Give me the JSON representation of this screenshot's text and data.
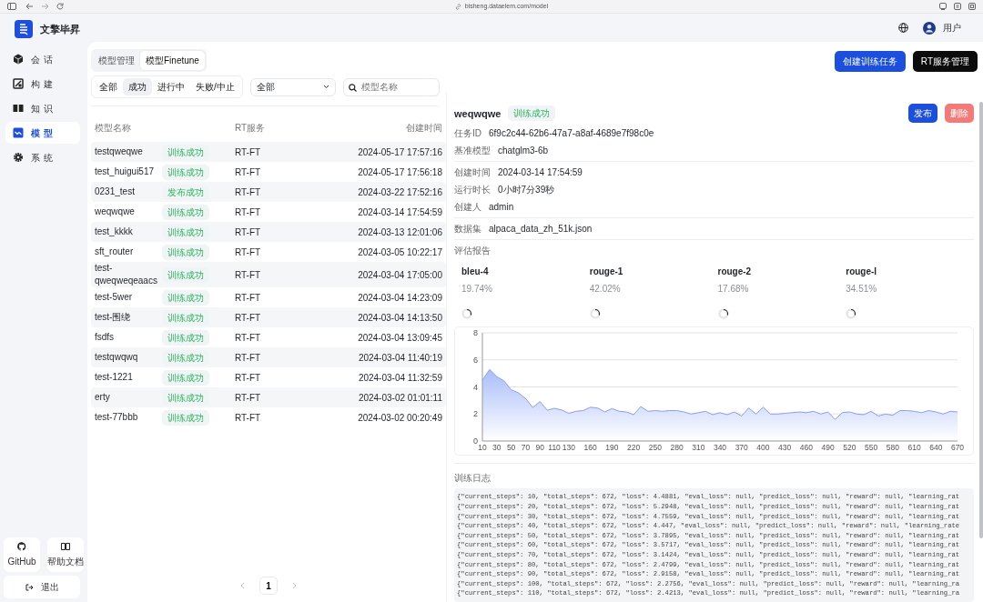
{
  "browser": {
    "url": "bisheng.dataelem.com/model"
  },
  "app": {
    "name": "文擎毕昇"
  },
  "header": {
    "user": "用户"
  },
  "sidebar": {
    "items": [
      {
        "label": "会话",
        "selected": false
      },
      {
        "label": "构建",
        "selected": false
      },
      {
        "label": "知识",
        "selected": false
      },
      {
        "label": "模型",
        "selected": true
      },
      {
        "label": "系统",
        "selected": false
      }
    ],
    "links": [
      {
        "label": "GitHub"
      },
      {
        "label": "帮助文档"
      }
    ],
    "logout": "退出"
  },
  "tabs": [
    {
      "label": "模型管理",
      "selected": false
    },
    {
      "label": "模型Finetune",
      "selected": true
    }
  ],
  "status_filter": [
    {
      "label": "全部",
      "selected": false
    },
    {
      "label": "成功",
      "selected": true
    },
    {
      "label": "进行中",
      "selected": false
    },
    {
      "label": "失败/中止",
      "selected": false
    }
  ],
  "type_select": {
    "value": "全部"
  },
  "search": {
    "placeholder": "模型名称"
  },
  "actions": [
    {
      "label": "创建训练任务",
      "kind": "primary"
    },
    {
      "label": "RT服务管理",
      "kind": "dark"
    }
  ],
  "table": {
    "columns": [
      "模型名称",
      "RT服务",
      "创建时间"
    ],
    "rows": [
      {
        "name": "testqweqwe",
        "status": "训练成功",
        "service": "RT-FT",
        "created": "2024-05-17 17:57:16"
      },
      {
        "name": "test_huigui517",
        "status": "训练成功",
        "service": "RT-FT",
        "created": "2024-05-17 17:56:18"
      },
      {
        "name": "0231_test",
        "status": "发布成功",
        "service": "RT-FT",
        "created": "2024-03-22 17:52:16"
      },
      {
        "name": "weqwqwe",
        "status": "训练成功",
        "service": "RT-FT",
        "created": "2024-03-14 17:54:59"
      },
      {
        "name": "test_kkkk",
        "status": "训练成功",
        "service": "RT-FT",
        "created": "2024-03-13 12:01:06"
      },
      {
        "name": "sft_router",
        "status": "训练成功",
        "service": "RT-FT",
        "created": "2024-03-05 10:22:17"
      },
      {
        "name": "test-qweqweqeaacs",
        "status": "训练成功",
        "service": "RT-FT",
        "created": "2024-03-04 17:05:00"
      },
      {
        "name": "test-5wer",
        "status": "训练成功",
        "service": "RT-FT",
        "created": "2024-03-04 14:23:09"
      },
      {
        "name": "test-围绕",
        "status": "训练成功",
        "service": "RT-FT",
        "created": "2024-03-04 14:13:50"
      },
      {
        "name": "fsdfs",
        "status": "训练成功",
        "service": "RT-FT",
        "created": "2024-03-04 13:09:45"
      },
      {
        "name": "testqwqwq",
        "status": "训练成功",
        "service": "RT-FT",
        "created": "2024-03-04 11:40:19"
      },
      {
        "name": "test-1221",
        "status": "训练成功",
        "service": "RT-FT",
        "created": "2024-03-04 11:32:59"
      },
      {
        "name": "erty",
        "status": "训练成功",
        "service": "RT-FT",
        "created": "2024-03-02 01:01:11"
      },
      {
        "name": "test-77bbb",
        "status": "训练成功",
        "service": "RT-FT",
        "created": "2024-03-02 00:20:49"
      }
    ]
  },
  "pagination": {
    "pages": [
      {
        "label": "1",
        "selected": true
      }
    ]
  },
  "detail": {
    "title": "weqwqwe",
    "status": "训练成功",
    "buttons": [
      {
        "label": "发布",
        "kind": "primary"
      },
      {
        "label": "删除",
        "kind": "danger"
      }
    ],
    "groups": [
      [
        {
          "label": "任务ID",
          "value": "6f9c2c44-62b6-47a7-a8af-4689e7f98c0e"
        },
        {
          "label": "基准模型",
          "value": "chatglm3-6b"
        }
      ],
      [
        {
          "label": "创建时间",
          "value": "2024-03-14 17:54:59"
        },
        {
          "label": "运行时长",
          "value": "0小时7分39秒"
        },
        {
          "label": "创建人",
          "value": "admin"
        }
      ],
      [
        {
          "label": "数据集",
          "value": "alpaca_data_zh_51k.json"
        }
      ]
    ],
    "report_title": "评估报告",
    "metrics": [
      {
        "name": "bleu-4",
        "value": "19.74%"
      },
      {
        "name": "rouge-1",
        "value": "42.02%"
      },
      {
        "name": "rouge-2",
        "value": "17.68%"
      },
      {
        "name": "rouge-l",
        "value": "34.51%"
      }
    ],
    "chart_data": {
      "type": "area",
      "grid": true,
      "xlim": [
        10,
        670
      ],
      "ylim": [
        0,
        8
      ],
      "yticks": [
        0,
        2,
        4,
        6,
        8
      ],
      "xticks": [
        10,
        30,
        50,
        70,
        90,
        110,
        130,
        160,
        190,
        220,
        250,
        280,
        310,
        340,
        370,
        400,
        430,
        460,
        490,
        520,
        550,
        580,
        610,
        640,
        670
      ],
      "x": [
        10,
        20,
        30,
        40,
        50,
        60,
        70,
        80,
        90,
        100,
        110,
        120,
        130,
        140,
        150,
        160,
        170,
        180,
        190,
        200,
        210,
        220,
        230,
        240,
        250,
        260,
        270,
        280,
        290,
        300,
        310,
        320,
        330,
        340,
        350,
        360,
        370,
        380,
        390,
        400,
        410,
        420,
        430,
        440,
        450,
        460,
        470,
        480,
        490,
        500,
        510,
        520,
        530,
        540,
        550,
        560,
        570,
        580,
        590,
        600,
        610,
        620,
        630,
        640,
        650,
        660,
        670
      ],
      "values": [
        4.49,
        5.29,
        4.76,
        4.45,
        3.79,
        3.57,
        3.14,
        2.48,
        2.92,
        2.28,
        2.42,
        2.3,
        2.05,
        2.2,
        2.25,
        2.5,
        2.45,
        2.15,
        2.4,
        2.2,
        2.15,
        1.95,
        2.55,
        2.2,
        2.25,
        2.2,
        2.25,
        2.25,
        2.15,
        2.0,
        2.1,
        2.2,
        1.95,
        2.1,
        1.95,
        2.15,
        1.85,
        2.45,
        2.0,
        2.5,
        2.0,
        2.0,
        2.05,
        2.1,
        2.15,
        2.1,
        2.2,
        2.0,
        2.15,
        1.6,
        2.1,
        2.15,
        2.0,
        1.95,
        2.2,
        1.85,
        2.0,
        1.9,
        2.25,
        2.25,
        2.2,
        2.1,
        2.25,
        2.15,
        2.0,
        2.2,
        2.15
      ]
    },
    "log_title": "训练日志",
    "log": [
      "{\"current_steps\": 10, \"total_steps\": 672, \"loss\": 4.4881, \"eval_loss\": null, \"predict_loss\": null, \"reward\": null, \"learning_rat",
      "{\"current_steps\": 20, \"total_steps\": 672, \"loss\": 5.2948, \"eval_loss\": null, \"predict_loss\": null, \"reward\": null, \"learning_rat",
      "{\"current_steps\": 30, \"total_steps\": 672, \"loss\": 4.7559, \"eval_loss\": null, \"predict_loss\": null, \"reward\": null, \"learning_rat",
      "{\"current_steps\": 40, \"total_steps\": 672, \"loss\": 4.447, \"eval_loss\": null, \"predict_loss\": null, \"reward\": null, \"learning_rate",
      "{\"current_steps\": 50, \"total_steps\": 672, \"loss\": 3.7895, \"eval_loss\": null, \"predict_loss\": null, \"reward\": null, \"learning_rat",
      "{\"current_steps\": 60, \"total_steps\": 672, \"loss\": 3.5717, \"eval_loss\": null, \"predict_loss\": null, \"reward\": null, \"learning_rat",
      "{\"current_steps\": 70, \"total_steps\": 672, \"loss\": 3.1424, \"eval_loss\": null, \"predict_loss\": null, \"reward\": null, \"learning_rat",
      "{\"current_steps\": 80, \"total_steps\": 672, \"loss\": 2.4799, \"eval_loss\": null, \"predict_loss\": null, \"reward\": null, \"learning_rat",
      "{\"current_steps\": 90, \"total_steps\": 672, \"loss\": 2.9158, \"eval_loss\": null, \"predict_loss\": null, \"reward\": null, \"learning_rat",
      "{\"current_steps\": 100, \"total_steps\": 672, \"loss\": 2.2756, \"eval_loss\": null, \"predict_loss\": null, \"reward\": null, \"learning_ra",
      "{\"current_steps\": 110, \"total_steps\": 672, \"loss\": 2.4213, \"eval_loss\": null, \"predict_loss\": null, \"reward\": null, \"learning_ra"
    ]
  }
}
